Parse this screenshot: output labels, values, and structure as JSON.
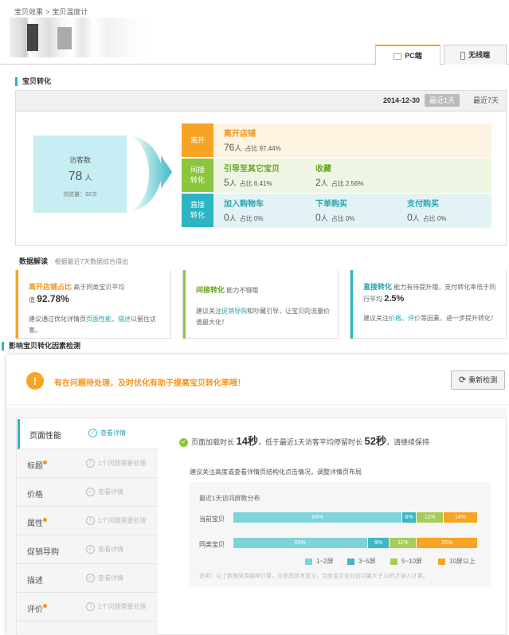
{
  "breadcrumb": {
    "item1": "宝贝效果",
    "sep": ">",
    "item2": "宝贝温度计"
  },
  "tabs": {
    "pc": "PC端",
    "mobile": "无线端"
  },
  "conversion": {
    "section_title": "宝贝转化",
    "date": "2014-12-30",
    "range_1day": "最近1天",
    "range_7day": "最近7天",
    "visitors_label": "访客数",
    "visitors_value": "78",
    "visitors_unit": "人",
    "pageviews": "浏览量：92次",
    "rows": {
      "leave": {
        "label": "离开",
        "title": "离开店铺",
        "value": "76",
        "unit": "人",
        "ratio": "占比 97.44%"
      },
      "indirect": {
        "label": "间接\n转化",
        "m1": {
          "title": "引导至其它宝贝",
          "value": "5",
          "unit": "人",
          "ratio": "占比 6.41%"
        },
        "m2": {
          "title": "收藏",
          "value": "2",
          "unit": "人",
          "ratio": "占比 2.56%"
        }
      },
      "direct": {
        "label": "直接\n转化",
        "m1": {
          "title": "加入购物车",
          "value": "0",
          "unit": "人",
          "ratio": "占比 0%"
        },
        "m2": {
          "title": "下单购买",
          "value": "0",
          "unit": "人",
          "ratio": "占比 0%"
        },
        "m3": {
          "title": "支付购买",
          "value": "0",
          "unit": "人",
          "ratio": "占比 0%"
        }
      }
    }
  },
  "interpretation": {
    "title": "数据解读",
    "subtitle": "根据最近7天数据综合得出",
    "card1": {
      "head": "离开店铺占比",
      "head2": "高于同类宝贝平均",
      "pre": "值",
      "value": "92.78%",
      "tip1": "建议通过优化详情页",
      "link1": "页面性能",
      "sep": "、",
      "link2": "描述",
      "tip2": "以留住访客。"
    },
    "card2": {
      "head": "间接转化",
      "head2": "能力不错哦",
      "tip1": "建议关注",
      "link1": "促销导购",
      "tip2": "和吵藏引导，让宝贝的流量价值最大化！"
    },
    "card3": {
      "head": "直接转化",
      "head2": "能力有待提升哦，支付转化率低于同行平均",
      "value": "2.5%",
      "tip1": "建议关注",
      "link1": "价格",
      "sep": "、",
      "link2": "评价",
      "tip2": "等因素，进一步提升转化！"
    }
  },
  "factors": {
    "section_title": "影响宝贝转化因素检测",
    "warning": "有在问题待处理，及时优化有助于提高宝贝转化率哦！",
    "recheck": "重新检测",
    "sidebar": [
      {
        "name": "页面性能",
        "status": "查看详情",
        "dot": false
      },
      {
        "name": "标题",
        "status": "1个问题需要处理",
        "dot": true
      },
      {
        "name": "价格",
        "status": "查看详情",
        "dot": false
      },
      {
        "name": "属性",
        "status": "1个问题需要处理",
        "dot": true
      },
      {
        "name": "促销导购",
        "status": "查看详情",
        "dot": false
      },
      {
        "name": "描述",
        "status": "查看详情",
        "dot": false
      },
      {
        "name": "评价",
        "status": "1个问题需要处理",
        "dot": true
      }
    ],
    "load": {
      "pre": "页面加载时长",
      "value": "14秒",
      "mid": "，低于最近1天访客平均停留时长",
      "value2": "52秒",
      "post": "，请继续保持"
    },
    "advice": "建议关注高度或查看详情页结构化点击情况，调整详情页布局",
    "chart_title": "最近1天访问屏数分布",
    "note": "说明：以上数据采用抽样计算，为更具参考意义，当前宝贝仅对访问量大于10的才纳入计算。"
  },
  "chart_data": {
    "type": "bar",
    "stacked": true,
    "orientation": "horizontal",
    "categories": [
      "当前宝贝",
      "同类宝贝"
    ],
    "series": [
      {
        "name": "1~2屏",
        "values": [
          69,
          55
        ],
        "labels": [
          "69%",
          "55%"
        ],
        "color": "#7ed3d9"
      },
      {
        "name": "3~5屏",
        "values": [
          6,
          9
        ],
        "labels": [
          "6%",
          "9%"
        ],
        "color": "#3fb7c2"
      },
      {
        "name": "5~10屏",
        "values": [
          11,
          11
        ],
        "labels": [
          "11%",
          "11%"
        ],
        "color": "#a6cd5a"
      },
      {
        "name": "10屏以上",
        "values": [
          14,
          25
        ],
        "labels": [
          "14%",
          "25%"
        ],
        "color": "#f7a323"
      }
    ]
  },
  "colors": {
    "accent_teal": "#2db5c3",
    "accent_orange": "#f7a323",
    "accent_green": "#8cc63f"
  }
}
